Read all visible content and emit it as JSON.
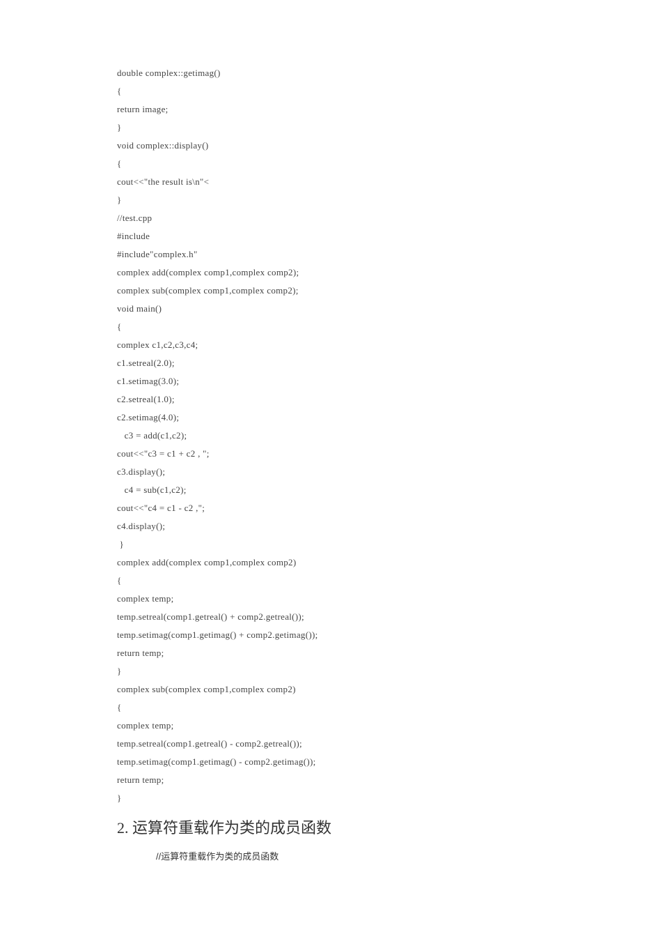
{
  "code_lines": [
    "double complex::getimag()",
    "{",
    "return image;",
    "}",
    "void complex::display()",
    "{",
    "cout<<\"the result is\\n\"<",
    "}",
    "//test.cpp",
    "#include",
    "#include\"complex.h\"",
    "complex add(complex comp1,complex comp2);",
    "complex sub(complex comp1,complex comp2);",
    "void main()",
    "{",
    "complex c1,c2,c3,c4;",
    "c1.setreal(2.0);",
    "c1.setimag(3.0);",
    "c2.setreal(1.0);",
    "c2.setimag(4.0);",
    "   c3 = add(c1,c2);",
    "cout<<\"c3 = c1 + c2 , \";",
    "c3.display();",
    "   c4 = sub(c1,c2);",
    "cout<<\"c4 = c1 - c2 ,\";",
    "c4.display();",
    " }",
    "complex add(complex comp1,complex comp2)",
    "{",
    "complex temp;",
    "temp.setreal(comp1.getreal() + comp2.getreal());",
    "temp.setimag(comp1.getimag() + comp2.getimag());",
    "return temp;",
    "}",
    "complex sub(complex comp1,complex comp2)",
    "{",
    "complex temp;",
    "temp.setreal(comp1.getreal() - comp2.getreal());",
    "temp.setimag(comp1.getimag() - comp2.getimag());",
    "return temp;",
    "}"
  ],
  "section_heading": "2. 运算符重载作为类的成员函数",
  "comment_line": "//运算符重载作为类的成员函数"
}
